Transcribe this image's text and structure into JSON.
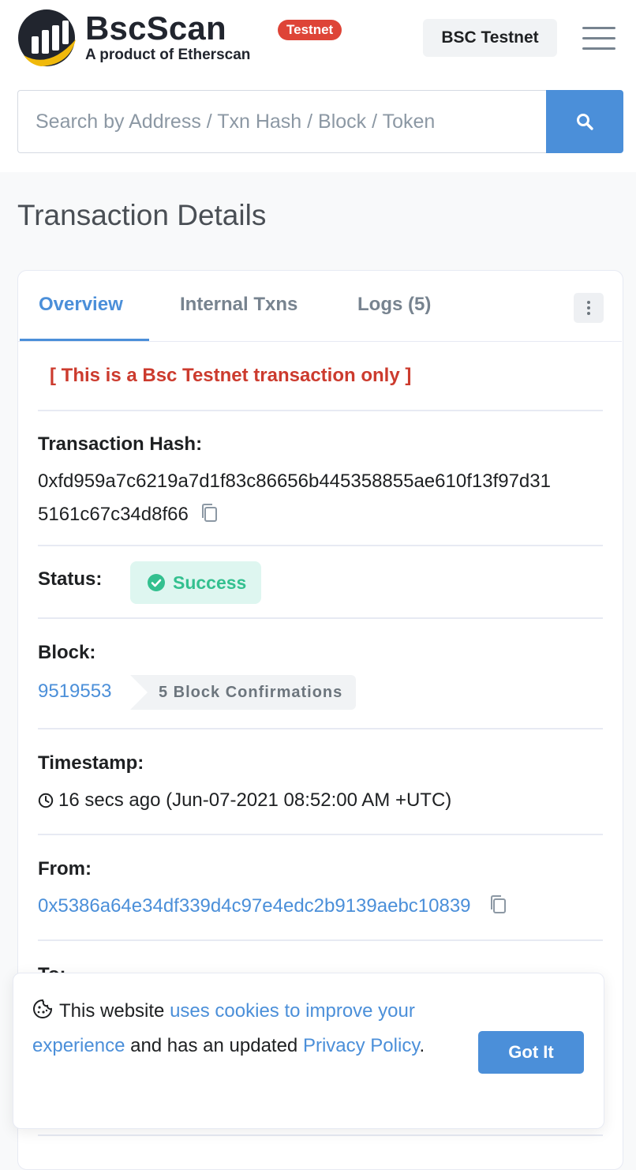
{
  "header": {
    "brand_name": "BscScan",
    "brand_tagline": "A product of Etherscan",
    "network_badge": "Testnet",
    "network_button": "BSC Testnet"
  },
  "search": {
    "placeholder": "Search by Address / Txn Hash / Block / Token"
  },
  "page": {
    "title": "Transaction Details"
  },
  "tabs": [
    {
      "label": "Overview",
      "active": true
    },
    {
      "label": "Internal Txns",
      "active": false
    },
    {
      "label": "Logs (5)",
      "active": false
    }
  ],
  "notice": "[ This is a Bsc Testnet transaction only ]",
  "details": {
    "tx_hash_label": "Transaction Hash:",
    "tx_hash_line1": "0xfd959a7c6219a7d1f83c86656b445358855ae610f13f97d31",
    "tx_hash_line2": "5161c67c34d8f66",
    "status_label": "Status:",
    "status_value": "Success",
    "block_label": "Block:",
    "block_number": "9519553",
    "block_confirmations": "5 Block Confirmations",
    "timestamp_label": "Timestamp:",
    "timestamp_value": "16 secs ago (Jun-07-2021 08:52:00 AM +UTC)",
    "from_label": "From:",
    "from_address": "0x5386a64e34df339d4c97e4edc2b9139aebc10839",
    "to_label": "To:"
  },
  "cookie_banner": {
    "text_1": "This website ",
    "link_1": "uses cookies to improve your experience",
    "text_2": " and has an updated ",
    "link_2": "Privacy Policy",
    "text_3": ".",
    "button": "Got It"
  },
  "colors": {
    "accent": "#4b8fd9",
    "danger": "#de4437",
    "success": "#33c08f",
    "brand_yellow": "#f0b90b"
  },
  "icons": {
    "logo": "bscscan-logo-icon",
    "search": "search-icon",
    "menu": "hamburger-menu-icon",
    "more": "more-vertical-icon",
    "copy": "copy-icon",
    "status": "check-circle-icon",
    "clock": "clock-icon",
    "cookie": "cookie-icon"
  }
}
